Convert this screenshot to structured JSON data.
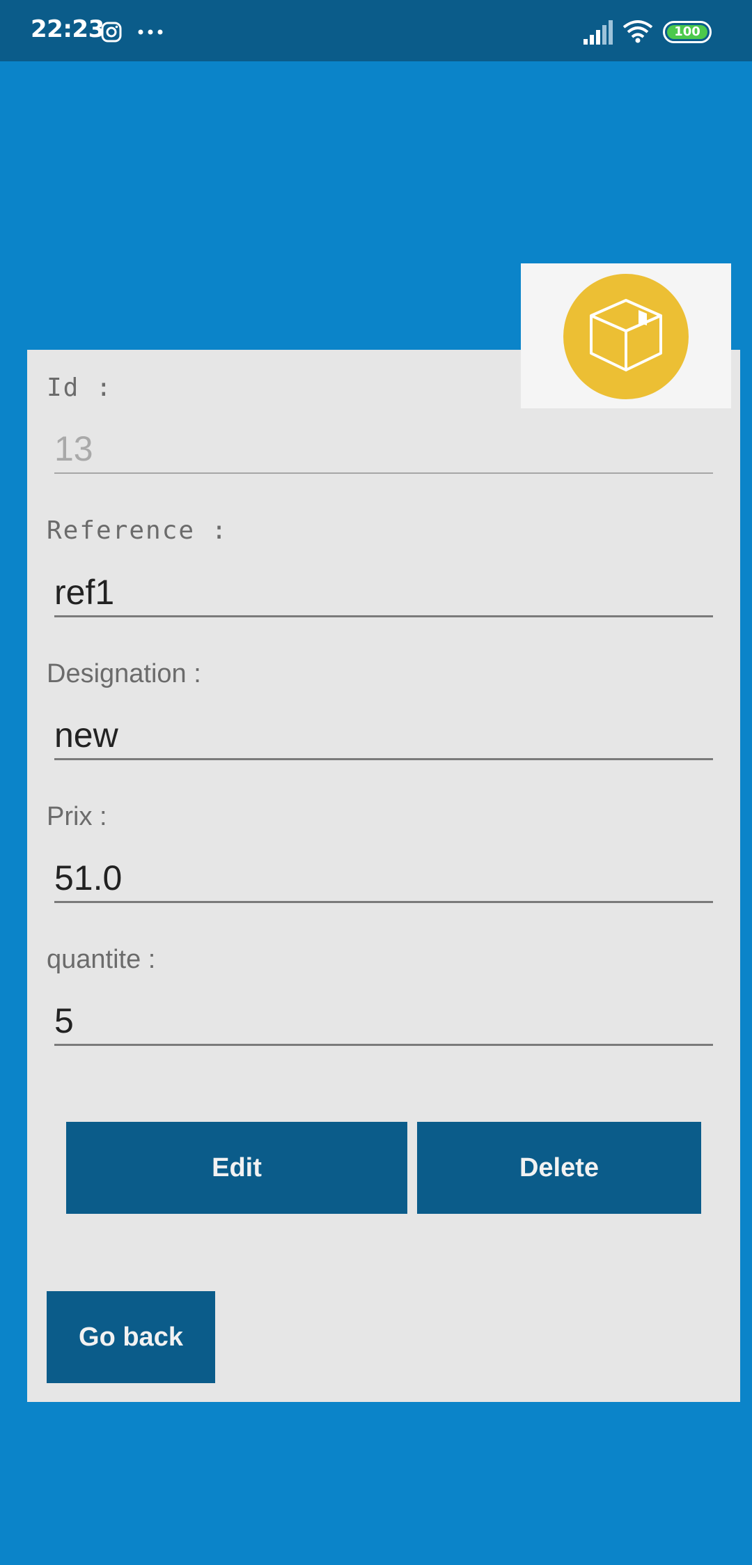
{
  "status_bar": {
    "time": "22:23",
    "battery": "100",
    "icons": [
      "instagram-icon",
      "more-dots-icon",
      "signal-icon",
      "wifi-icon",
      "battery-icon"
    ]
  },
  "logo": {
    "icon": "box-icon",
    "accent_color": "#ecbf34"
  },
  "form": {
    "id": {
      "label": "Id :",
      "value": "13"
    },
    "reference": {
      "label": "Reference :",
      "value": "ref1"
    },
    "designation": {
      "label": "Designation :",
      "value": "new"
    },
    "prix": {
      "label": "Prix :",
      "value": "51.0"
    },
    "quantite": {
      "label": "quantite :",
      "value": "5"
    }
  },
  "buttons": {
    "edit": "Edit",
    "delete": "Delete",
    "go_back": "Go back"
  },
  "colors": {
    "background": "#0b84c9",
    "status_bar": "#0b5c8a",
    "card": "#e6e6e6",
    "button": "#0b5c8a"
  }
}
